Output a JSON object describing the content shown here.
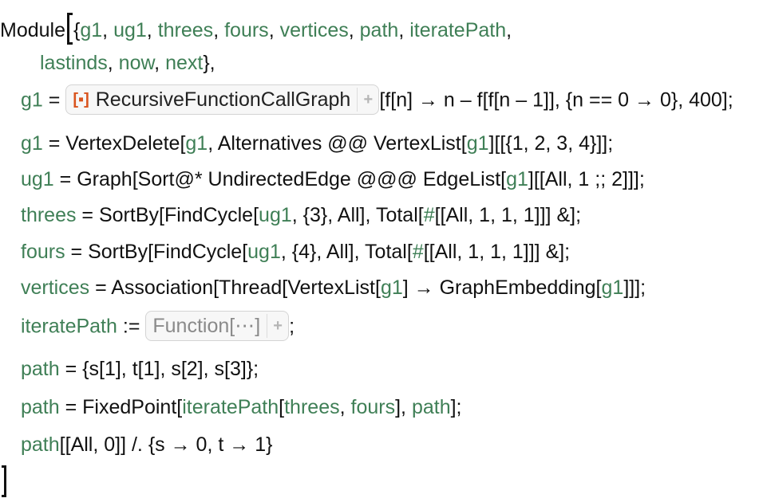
{
  "notebook": {
    "module_head": "Module",
    "locals_line1": [
      "g1",
      "ug1",
      "threes",
      "fours",
      "vertices",
      "path",
      "iteratePath"
    ],
    "locals_line2": [
      "lastinds",
      "now",
      "next"
    ],
    "line_g1": {
      "var": "g1",
      "op": "=",
      "iconized_label": "RecursiveFunctionCallGraph",
      "iconized_icon": "[▪]",
      "plus": "+",
      "args_pre": "[",
      "args": "f[n] → n – f[f[n – 1]], {n == 0 → 0}, 400];"
    },
    "line_vertexdelete": {
      "var": "g1",
      "text_a": " = VertexDelete[",
      "inner_var": "g1",
      "text_b": ", Alternatives @@ VertexList[",
      "inner_var2": "g1",
      "text_c": "][[{1, 2, 3, 4}]];"
    },
    "line_ug1": {
      "var": "ug1",
      "text_a": " = Graph[Sort@* UndirectedEdge @@@ EdgeList[",
      "inner_var": "g1",
      "text_b": "][[All, 1 ;; 2]]];"
    },
    "line_threes": {
      "var": "threes",
      "text_a": " = SortBy[FindCycle[",
      "inner_var": "ug1",
      "text_b": ", {3}, All], Total[",
      "slot": "#",
      "text_c": "[[All, 1, 1, 1]]] &];"
    },
    "line_fours": {
      "var": "fours",
      "text_a": " = SortBy[FindCycle[",
      "inner_var": "ug1",
      "text_b": ", {4}, All], Total[",
      "slot": "#",
      "text_c": "[[All, 1, 1, 1]]] &];"
    },
    "line_vertices": {
      "var": "vertices",
      "text_a": " = Association[Thread[VertexList[",
      "inner_var": "g1",
      "text_b": "] → GraphEmbedding[",
      "inner_var2": "g1",
      "text_c": "]]];"
    },
    "line_iterate": {
      "var": "iteratePath",
      "op": " := ",
      "iconized_label": "Function[⋯]",
      "plus": "+",
      "tail": ";"
    },
    "line_path1": {
      "var": "path",
      "text": " = {s[1], t[1], s[2], s[3]};"
    },
    "line_path2": {
      "var": "path",
      "text_a": " = FixedPoint[",
      "fn": "iteratePath",
      "text_b": "[",
      "arg1": "threes",
      "text_c": ", ",
      "arg2": "fours",
      "text_d": "], ",
      "arg3": "path",
      "text_e": "];"
    },
    "line_path3": {
      "var": "path",
      "text": "[[All, 0]] /. {s → 0, t → 1}"
    }
  },
  "colors": {
    "local_variable": "#3f7f56",
    "text": "#111111",
    "iconized_accent": "#d9541e",
    "iconized_gray_label": "#8a8a8a"
  }
}
